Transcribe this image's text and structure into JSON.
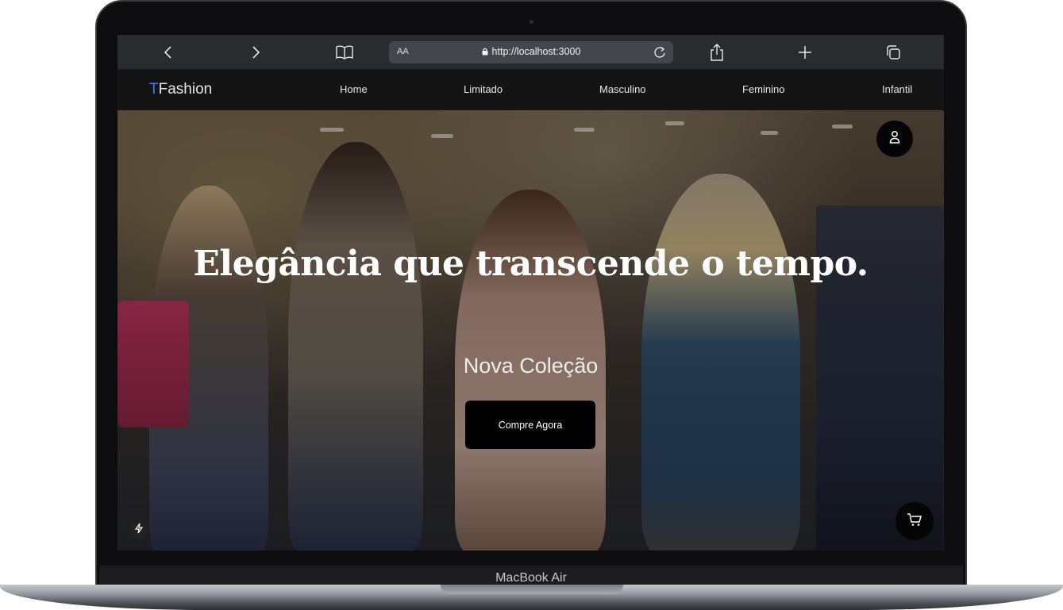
{
  "device": {
    "label": "MacBook Air"
  },
  "browser": {
    "url": "http://localhost:3000",
    "text_size_label": "AA",
    "icons": [
      "back-icon",
      "forward-icon",
      "bookmarks-icon",
      "lock-icon",
      "reload-icon",
      "share-icon",
      "new-tab-icon",
      "tabs-icon"
    ]
  },
  "site": {
    "logo_mark": "T",
    "logo_rest": "Fashion",
    "nav": [
      "Home",
      "Limitado",
      "Masculino",
      "Feminino",
      "Infantil"
    ],
    "accent_color": "#3b7bff"
  },
  "hero": {
    "headline": "Elegância que transcende o tempo.",
    "subtitle": "Nova Coleção",
    "cta_label": "Compre Agora",
    "icons": [
      "user-icon",
      "cart-icon",
      "bolt-icon"
    ]
  }
}
